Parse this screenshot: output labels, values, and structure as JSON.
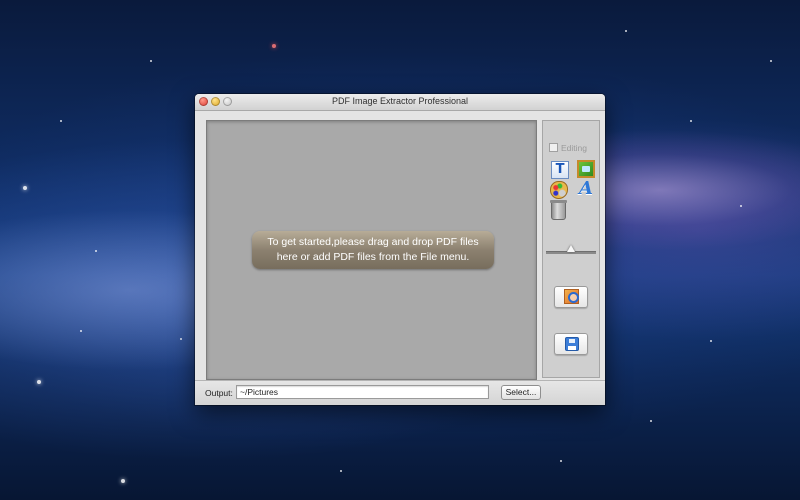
{
  "window": {
    "title": "PDF Image Extractor Professional"
  },
  "main": {
    "hint_line1": "To get started,please drag and drop PDF files",
    "hint_line2": "here or add PDF files from the File menu."
  },
  "side_panel": {
    "editing_label": "Editing",
    "editing_checked": false,
    "tools": [
      "text-tool-icon",
      "image-tool-icon",
      "palette-tool-icon",
      "font-tool-icon",
      "trash-icon"
    ],
    "slider_value": 0.5
  },
  "output": {
    "label": "Output:",
    "value": "~/Pictures",
    "select_label": "Select..."
  }
}
